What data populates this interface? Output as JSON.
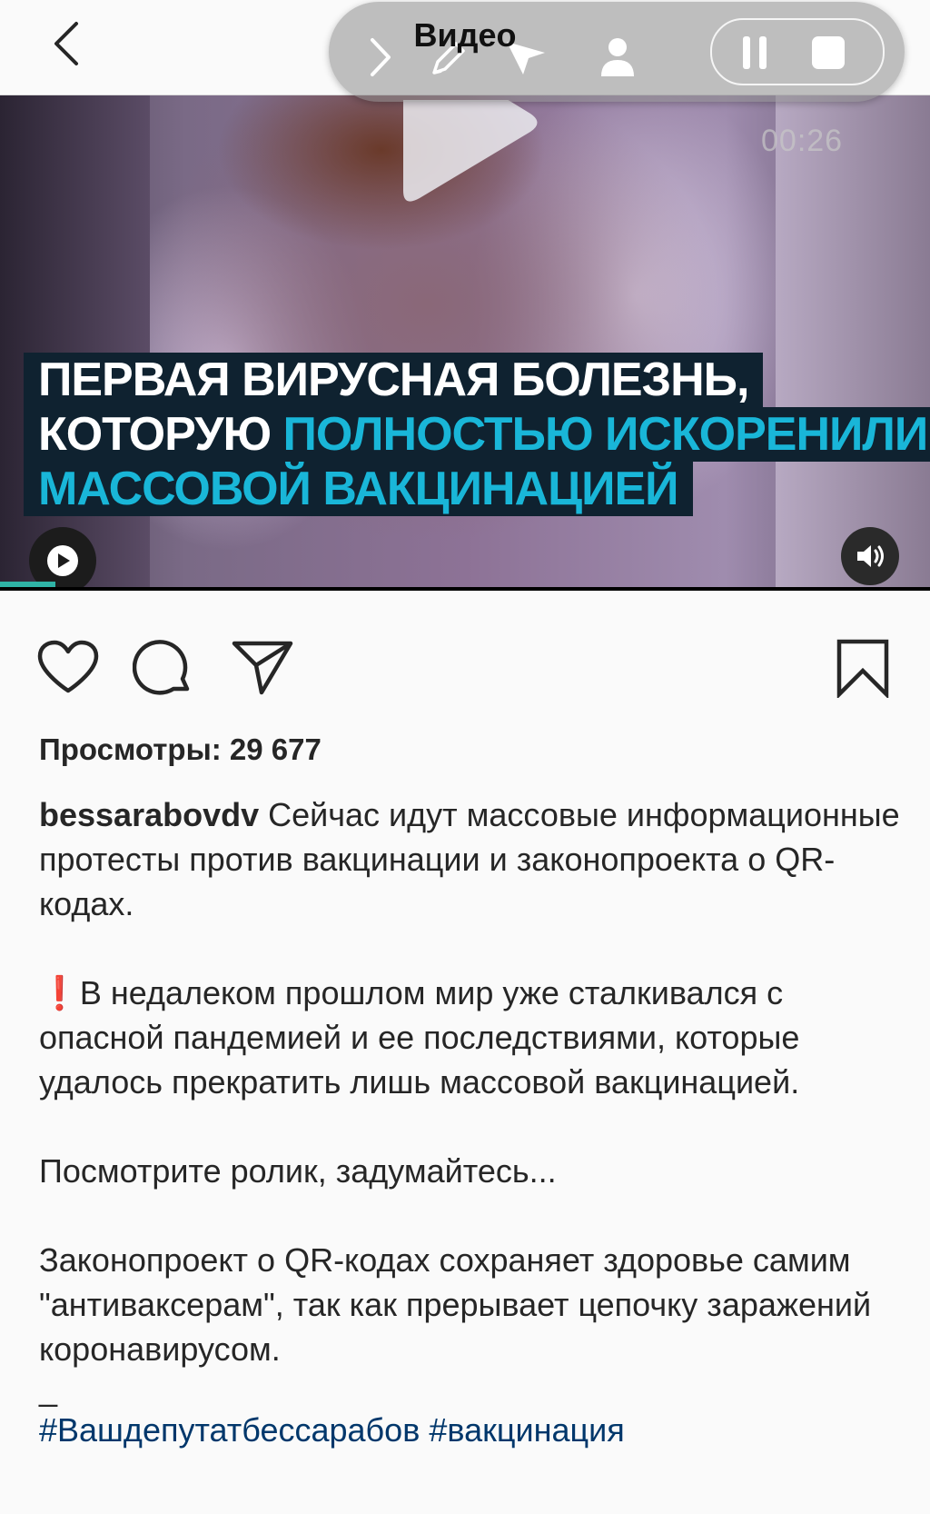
{
  "header": {
    "title": "Видео"
  },
  "recorder": {
    "time": "00:26"
  },
  "video": {
    "caption_lines": [
      {
        "plain": "ПЕРВАЯ ВИРУСНАЯ БОЛЕЗНЬ,",
        "highlight": ""
      },
      {
        "plain": "КОТОРУЮ ",
        "highlight": "ПОЛНОСТЬЮ ИСКОРЕНИЛИ"
      },
      {
        "plain": "",
        "highlight": "МАССОВОЙ ВАКЦИНАЦИЕЙ"
      }
    ],
    "progress": 0.06
  },
  "post": {
    "views_label": "Просмотры: 29 677",
    "username": "bessarabovdv",
    "intro": " Сейчас идут массовые информационные протесты против вакцинации и законопроекта о QR-кодах.",
    "para2_mark": "❗",
    "para2": "В недалеком прошлом мир уже сталкивался с опасной пандемией и ее последствиями, которые удалось прекратить лишь массовой вакцинацией.",
    "para3": "Посмотрите ролик, задумайтесь...",
    "para4": "Законопроект о QR-кодах сохраняет здоровье самим \"антиваксерам\", так как прерывает цепочку заражений коронавирусом.",
    "dash": "_",
    "hashtags": "#Вашдепутатбессарабов #вакцинация"
  },
  "colors": {
    "accent": "#19b6d8",
    "link": "#00376b",
    "caption_bg": "#0f2230"
  }
}
